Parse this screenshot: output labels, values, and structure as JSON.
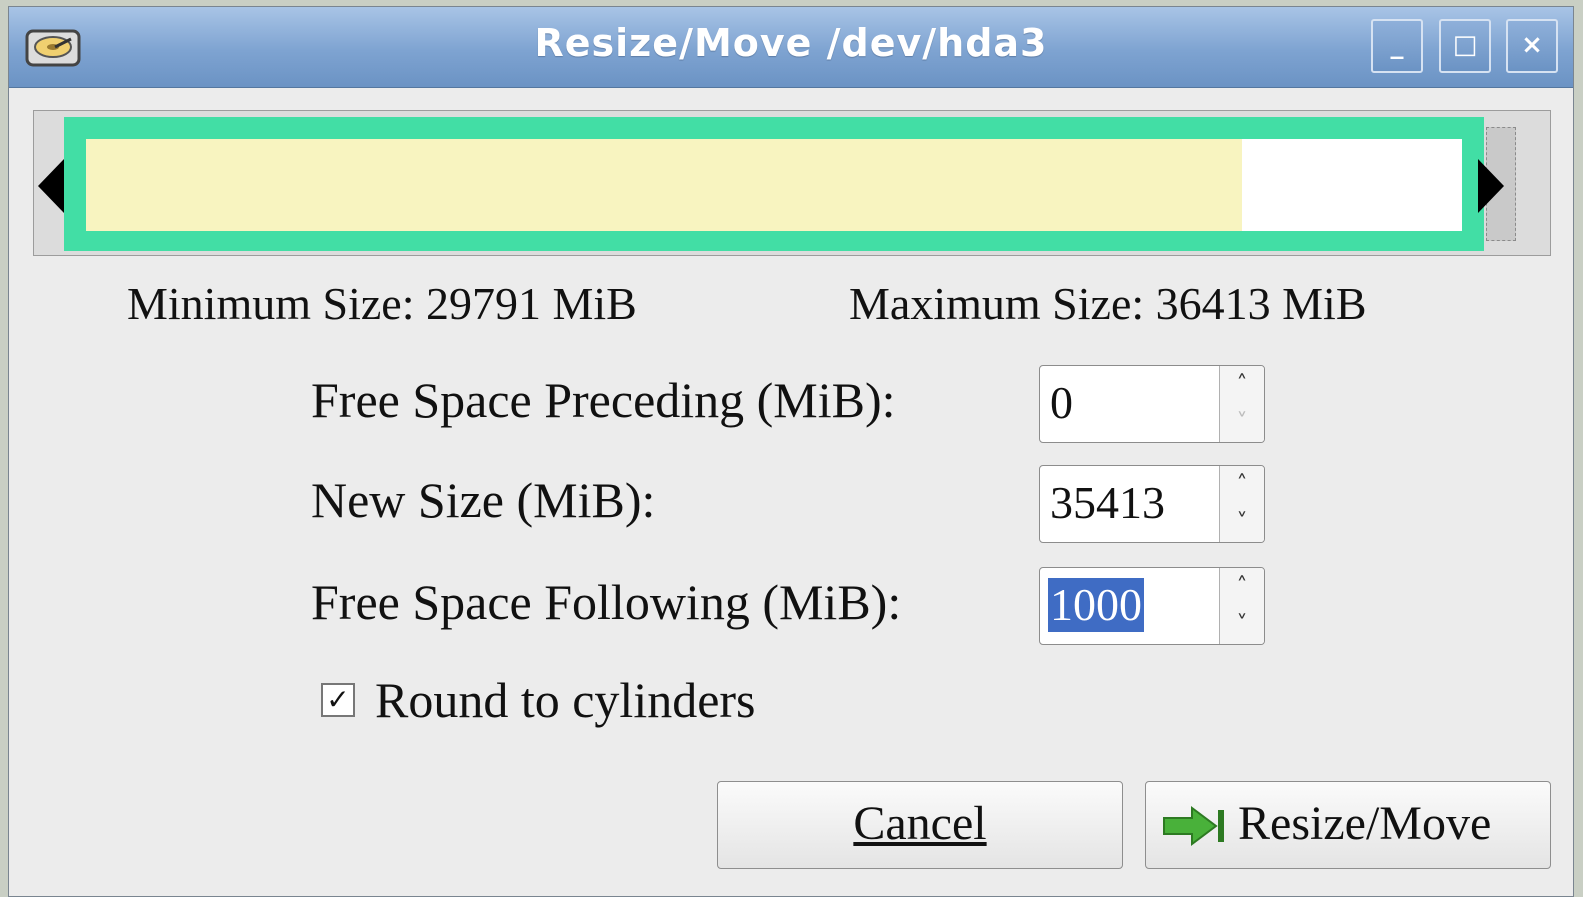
{
  "window": {
    "title": "Resize/Move /dev/hda3",
    "minimize_glyph": "_",
    "maximize_glyph": "□",
    "close_glyph": "×",
    "app_icon": "harddisk-icon"
  },
  "partition_graph": {
    "used_fraction": 0.84,
    "colors": {
      "border": "#42dea5",
      "used": "#f8f4c0",
      "unused": "#ffffff"
    }
  },
  "limits": {
    "minimum": "Minimum Size: 29791 MiB",
    "maximum": "Maximum Size: 36413 MiB"
  },
  "fields": {
    "preceding": {
      "label": "Free Space Preceding (MiB):",
      "value": "0"
    },
    "new_size": {
      "label": "New Size (MiB):",
      "value": "35413"
    },
    "following": {
      "label": "Free Space Following (MiB):",
      "value": "1000"
    }
  },
  "round_to_cylinders": {
    "label": "Round to cylinders",
    "checked": true,
    "check_glyph": "✓"
  },
  "buttons": {
    "cancel_label": "Cancel",
    "resize_label": "Resize/Move",
    "resize_icon": "go-arrow-icon"
  },
  "spin_glyphs": {
    "up": "˄",
    "down": "˅"
  }
}
